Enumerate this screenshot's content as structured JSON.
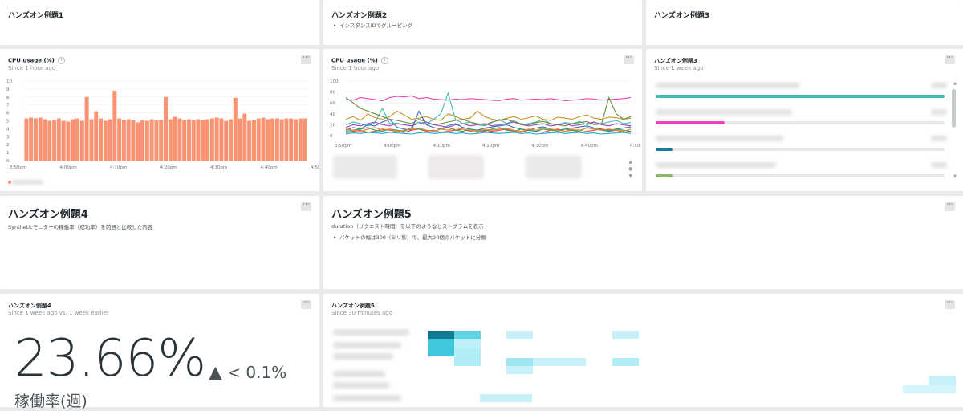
{
  "widgets": {
    "w1": {
      "title": "ハンズオン例題1"
    },
    "w2": {
      "title": "ハンズオン例題2",
      "bullets": [
        "インスタンスIDでグルーピング"
      ]
    },
    "w3": {
      "title": "ハンズオン例題3"
    },
    "cpu1": {
      "title": "CPU usage (%)",
      "subtitle": "Since 1 hour ago",
      "menu": "···",
      "info": "i",
      "chart_data": {
        "type": "bar",
        "title": "CPU usage (%)",
        "ylim": [
          0,
          10
        ],
        "yticks": [
          "10",
          "9",
          "8",
          "7",
          "6",
          "5",
          "4",
          "3",
          "2",
          "1",
          "0"
        ],
        "xticks": [
          "3:50pm",
          "4:00pm",
          "4:10pm",
          "4:20pm",
          "4:30pm",
          "4:40pm",
          "4:50p"
        ],
        "values": [
          5.3,
          5.4,
          5.3,
          5.4,
          5.2,
          5.0,
          5.1,
          5.3,
          5.0,
          4.9,
          5.2,
          5.3,
          5.0,
          8.0,
          5.2,
          6.2,
          5.3,
          5.0,
          5.2,
          8.8,
          5.3,
          5.1,
          5.2,
          5.1,
          4.8,
          5.1,
          5.0,
          5.2,
          5.1,
          5.1,
          8.0,
          5.2,
          5.5,
          5.3,
          5.1,
          5.2,
          5.1,
          5.2,
          5.1,
          5.2,
          5.3,
          5.4,
          5.3,
          5.0,
          5.2,
          7.9,
          5.3,
          5.9,
          5.0,
          5.1,
          5.3,
          5.4,
          5.2,
          5.3,
          5.3,
          5.2,
          5.3,
          5.3,
          5.2,
          5.3,
          5.3
        ],
        "color": "#f99371"
      }
    },
    "cpu2": {
      "title": "CPU usage (%)",
      "subtitle": "Since 1 hour ago",
      "menu": "···",
      "info": "i",
      "chart_data": {
        "type": "line",
        "title": "CPU usage (%)",
        "ylim": [
          0,
          100
        ],
        "yticks": [
          "100",
          "80",
          "60",
          "40",
          "20",
          "0"
        ],
        "xticks": [
          "3:50pm",
          "4:00pm",
          "4:10pm",
          "4:20pm",
          "4:30pm",
          "4:40pm",
          "4:50"
        ],
        "series": [
          {
            "color": "#e845b8",
            "values": [
              66,
              65,
              70,
              68,
              66,
              64,
              70,
              72,
              71,
              73,
              68,
              70,
              67,
              66,
              65,
              67,
              66,
              68,
              67,
              66,
              65,
              64,
              67,
              68,
              65,
              66,
              67,
              66,
              68,
              66,
              64,
              65,
              66,
              68,
              67,
              65,
              66,
              67,
              68,
              70
            ]
          },
          {
            "color": "#3fbfb0",
            "values": [
              20,
              25,
              22,
              18,
              24,
              50,
              22,
              23,
              20,
              18,
              25,
              21,
              30,
              40,
              78,
              30,
              22,
              25,
              20,
              18,
              24,
              30,
              22,
              28,
              20,
              22,
              25,
              30,
              22,
              20,
              24,
              22,
              26,
              20,
              24,
              22,
              25,
              28,
              22,
              24
            ]
          },
          {
            "color": "#c5932e",
            "values": [
              30,
              35,
              28,
              40,
              33,
              30,
              35,
              45,
              38,
              30,
              32,
              35,
              30,
              28,
              40,
              35,
              30,
              32,
              45,
              35,
              30,
              28,
              32,
              35,
              30,
              33,
              36,
              30,
              28,
              34,
              32,
              30,
              35,
              38,
              32,
              30,
              34,
              33,
              30,
              32
            ]
          },
          {
            "color": "#6a8d3c",
            "values": [
              70,
              60,
              50,
              45,
              40,
              35,
              30,
              28,
              25,
              22,
              30,
              25,
              20,
              22,
              25,
              28,
              30,
              25,
              22,
              20,
              25,
              28,
              30,
              25,
              22,
              20,
              24,
              26,
              22,
              20,
              18,
              22,
              24,
              26,
              20,
              22,
              70,
              40,
              30,
              35
            ]
          },
          {
            "color": "#3d6eb5",
            "values": [
              10,
              15,
              12,
              20,
              18,
              25,
              30,
              15,
              12,
              10,
              45,
              20,
              15,
              12,
              18,
              22,
              15,
              12,
              10,
              14,
              16,
              18,
              20,
              15,
              12,
              10,
              14,
              16,
              12,
              10,
              12,
              14,
              16,
              18,
              14,
              12,
              10,
              12,
              14,
              16
            ]
          },
          {
            "color": "#9c4ac2",
            "values": [
              15,
              20,
              18,
              22,
              25,
              20,
              18,
              22,
              20,
              18,
              22,
              25,
              20,
              18,
              15,
              20,
              22,
              18,
              20,
              22,
              18,
              20,
              22,
              25,
              20,
              18,
              20,
              22,
              18,
              20,
              22,
              18,
              20,
              22,
              25,
              20,
              18,
              22,
              20,
              18
            ]
          },
          {
            "color": "#d94b4b",
            "values": [
              5,
              8,
              10,
              6,
              8,
              12,
              10,
              8,
              6,
              10,
              12,
              8,
              10,
              6,
              8,
              10,
              12,
              8,
              6,
              10,
              8,
              10,
              12,
              8,
              6,
              10,
              8,
              6,
              10,
              12,
              8,
              10,
              6,
              8,
              10,
              12,
              8,
              10,
              6,
              8
            ]
          },
          {
            "color": "#2f9e62",
            "values": [
              8,
              10,
              12,
              15,
              10,
              8,
              12,
              10,
              8,
              15,
              12,
              10,
              8,
              12,
              15,
              10,
              8,
              12,
              10,
              8,
              12,
              15,
              10,
              8,
              12,
              10,
              8,
              12,
              10,
              8,
              12,
              10,
              8,
              15,
              12,
              10,
              8,
              12,
              10,
              8
            ]
          },
          {
            "color": "#e08a2c",
            "values": [
              12,
              10,
              8,
              12,
              15,
              10,
              12,
              8,
              10,
              12,
              14,
              10,
              8,
              12,
              10,
              14,
              12,
              10,
              8,
              12,
              10,
              12,
              14,
              10,
              8,
              12,
              10,
              14,
              12,
              10,
              8,
              12,
              10,
              14,
              12,
              10,
              12,
              10,
              8,
              12
            ]
          },
          {
            "color": "#2aa6c9",
            "values": [
              3,
              5,
              4,
              6,
              5,
              4,
              6,
              5,
              4,
              3,
              5,
              6,
              4,
              5,
              6,
              4,
              5,
              3,
              4,
              6,
              5,
              4,
              5,
              6,
              4,
              5,
              3,
              4,
              5,
              6,
              4,
              5,
              6,
              4,
              5,
              3,
              4,
              5,
              6,
              4
            ]
          }
        ]
      }
    },
    "w3list": {
      "title": "ハンズオン例題3",
      "subtitle": "Since 1 week ago",
      "menu": "···",
      "chart_data": {
        "type": "bar",
        "orientation": "horizontal",
        "values": [
          100,
          24,
          6,
          6
        ],
        "max": 100,
        "colors": [
          "#3fbfb0",
          "#e845b8",
          "#1a7b9c",
          "#8cb66a"
        ]
      }
    },
    "w4": {
      "title": "ハンズオン例題4",
      "menu": "···",
      "description": "Syntheticモニターの稼働率（成功率）を前週と比較した内容"
    },
    "w5": {
      "title": "ハンズオン例題5",
      "menu": "···",
      "description": "duration（リクエスト時間）を以下のようなヒストグラムを表示",
      "bullets": [
        "バケットの幅は300（ミリ秒）で、最大20個のバケットに分類"
      ]
    },
    "w4b": {
      "title": "ハンズオン例題4",
      "subtitle": "Since 1 week ago vs. 1 week earlier",
      "menu": "···",
      "value": "23.66%",
      "delta_symbol": "▲",
      "delta": "< 0.1%",
      "caption": "稼働率(週)"
    },
    "w5b": {
      "title": "ハンズオン例題5",
      "subtitle": "Since 30 minutes ago",
      "menu": "···"
    }
  }
}
